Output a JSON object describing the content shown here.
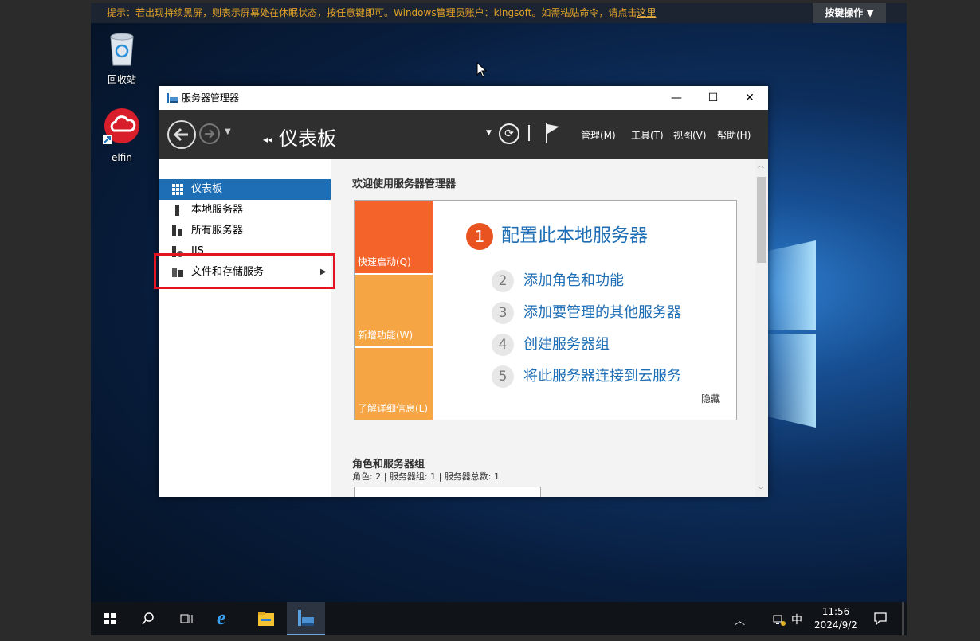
{
  "notice": {
    "text": "提示：若出现持续黑屏，则表示屏幕处在休眠状态，按任意键即可。Windows管理员账户：kingsoft。如需粘贴命令，请点击",
    "link": "这里",
    "key_button": "按键操作 ▼"
  },
  "desktop_icons": {
    "recycle_bin": "回收站",
    "elfin": "elfin"
  },
  "window": {
    "title": "服务器管理器",
    "breadcrumb": "仪表板",
    "menus": [
      "管理(M)",
      "工具(T)",
      "视图(V)",
      "帮助(H)"
    ]
  },
  "sidebar": {
    "items": [
      {
        "label": "仪表板"
      },
      {
        "label": "本地服务器"
      },
      {
        "label": "所有服务器"
      },
      {
        "label": "IIS"
      },
      {
        "label": "文件和存储服务"
      }
    ]
  },
  "content": {
    "welcome": "欢迎使用服务器管理器",
    "tiles": [
      "快速启动(Q)",
      "新增功能(W)",
      "了解详细信息(L)"
    ],
    "steps": [
      {
        "num": "1",
        "label": "配置此本地服务器"
      },
      {
        "num": "2",
        "label": "添加角色和功能"
      },
      {
        "num": "3",
        "label": "添加要管理的其他服务器"
      },
      {
        "num": "4",
        "label": "创建服务器组"
      },
      {
        "num": "5",
        "label": "将此服务器连接到云服务"
      }
    ],
    "hide": "隐藏",
    "roles_title": "角色和服务器组",
    "roles_summary": "角色: 2 | 服务器组: 1 | 服务器总数: 1"
  },
  "taskbar": {
    "time": "11:56",
    "date": "2024/9/2",
    "ime": "中"
  },
  "colors": {
    "accent": "#1e6eb5",
    "tile_dark": "#f4642a",
    "tile_light": "#f6a544",
    "highlight": "#e2141f"
  }
}
